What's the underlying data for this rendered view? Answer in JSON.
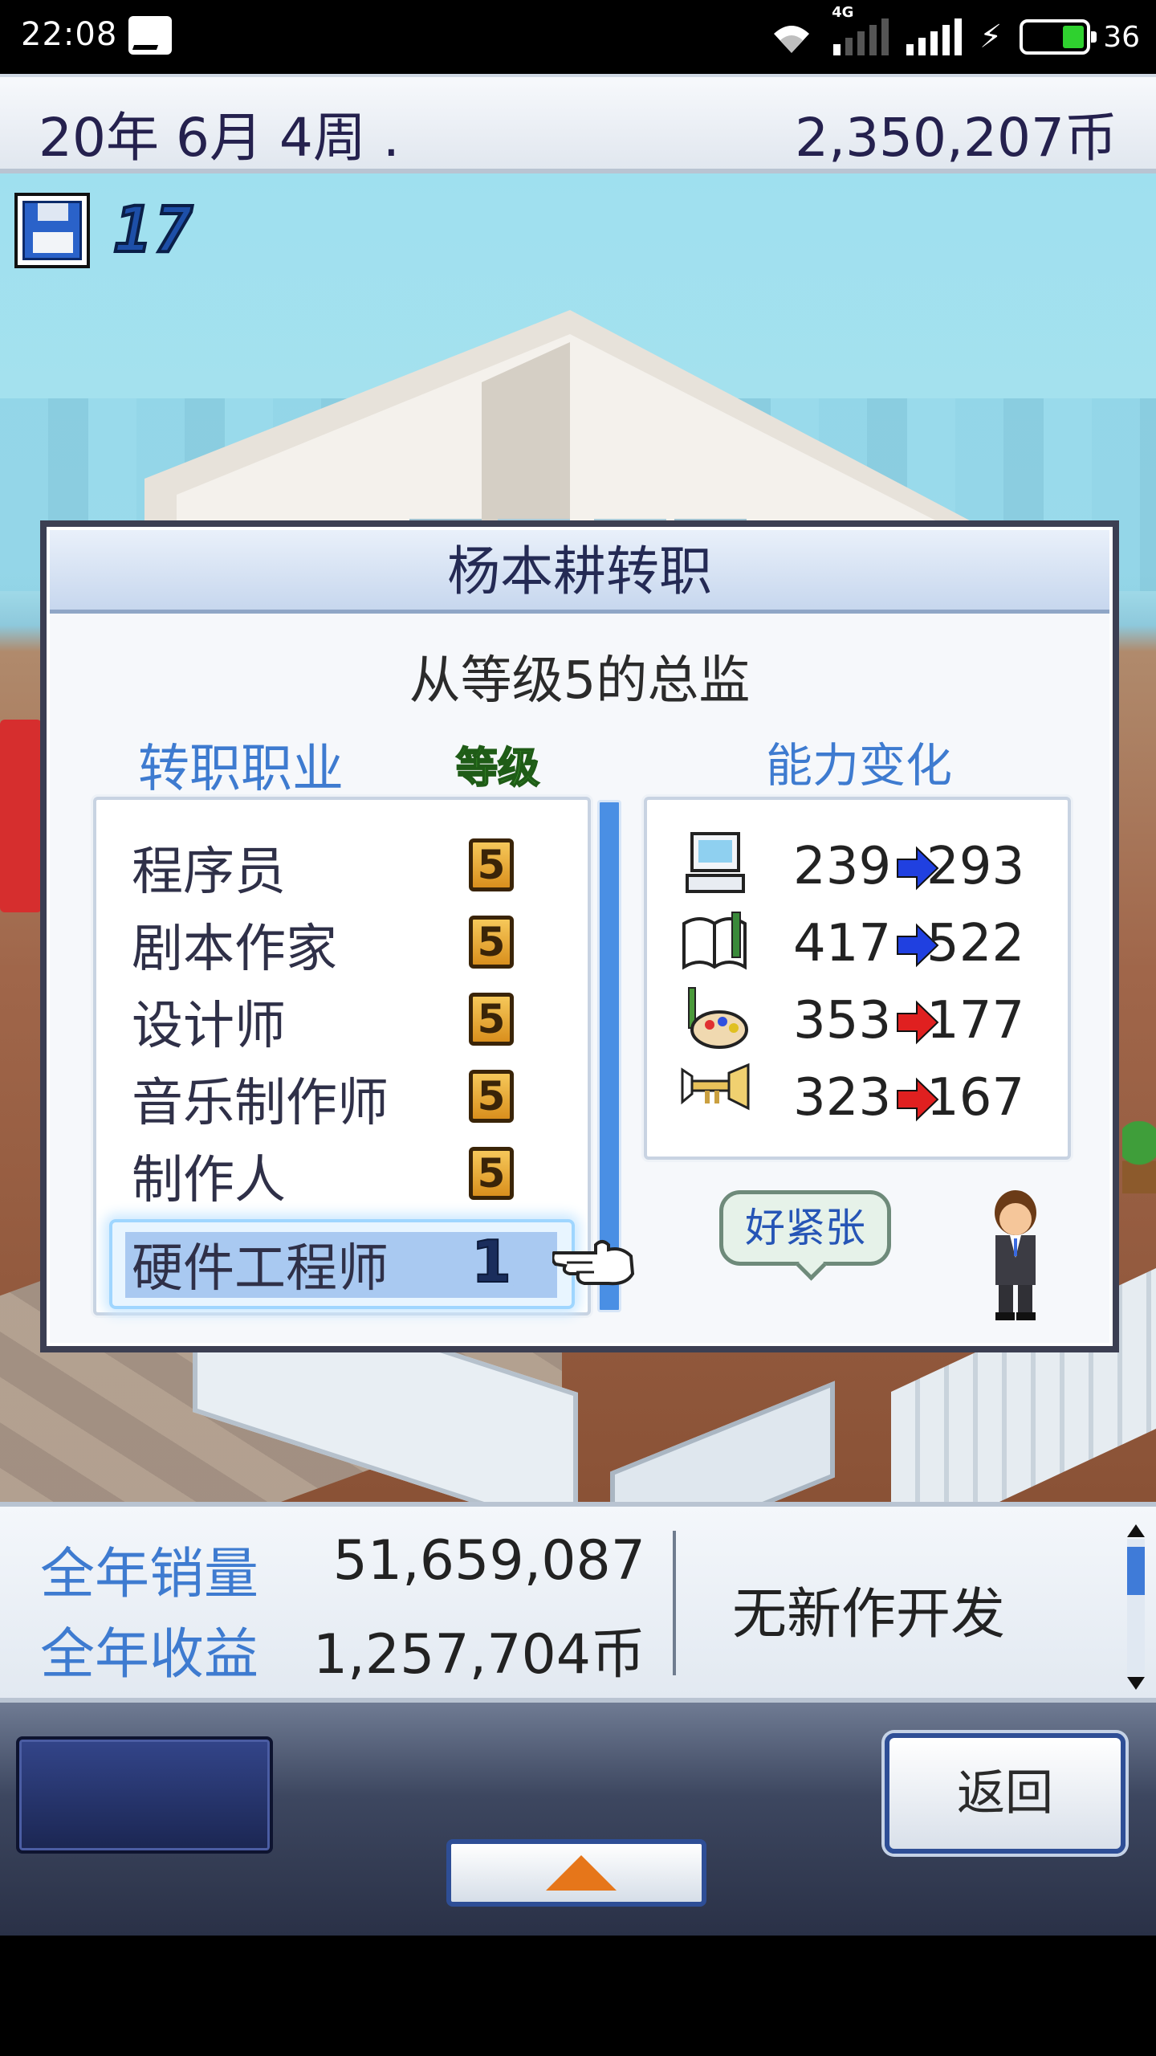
{
  "status_bar": {
    "time": "22:08",
    "network_label": "4G",
    "battery_percent": "36",
    "battery_level": 0.36
  },
  "top_info": {
    "date": "20年 6月 4周 .",
    "money": "2,350,207币"
  },
  "scene": {
    "save_count": "17"
  },
  "dialog": {
    "title": "杨本耕转职",
    "subtitle": "从等级5的总监",
    "job_header": "转职职业",
    "level_header": "等级",
    "ability_header": "能力变化",
    "jobs": [
      {
        "name": "程序员",
        "level": "5"
      },
      {
        "name": "剧本作家",
        "level": "5"
      },
      {
        "name": "设计师",
        "level": "5"
      },
      {
        "name": "音乐制作师",
        "level": "5"
      },
      {
        "name": "制作人",
        "level": "5"
      },
      {
        "name": "硬件工程师",
        "level": "1"
      }
    ],
    "selected_job_index": 5,
    "abilities": [
      {
        "icon": "computer-icon",
        "from": "239",
        "to": "293",
        "direction": "up",
        "arrow_color": "#2040e0"
      },
      {
        "icon": "book-icon",
        "from": "417",
        "to": "522",
        "direction": "up",
        "arrow_color": "#2040e0"
      },
      {
        "icon": "palette-icon",
        "from": "353",
        "to": "177",
        "direction": "down",
        "arrow_color": "#e02020"
      },
      {
        "icon": "trumpet-icon",
        "from": "323",
        "to": "167",
        "direction": "down",
        "arrow_color": "#e02020"
      }
    ],
    "speech_bubble": "好紧张"
  },
  "sales": {
    "annual_sales_label": "全年销量",
    "annual_sales_value": "51,659,087",
    "annual_revenue_label": "全年收益",
    "annual_revenue_value": "1,257,704币",
    "dev_status": "无新作开发"
  },
  "controls": {
    "back_label": "返回"
  },
  "colors": {
    "accent_blue": "#3e7bd0",
    "title_text": "#242a54",
    "level_badge": "#e6a63a",
    "selection": "#a9c9f1"
  }
}
